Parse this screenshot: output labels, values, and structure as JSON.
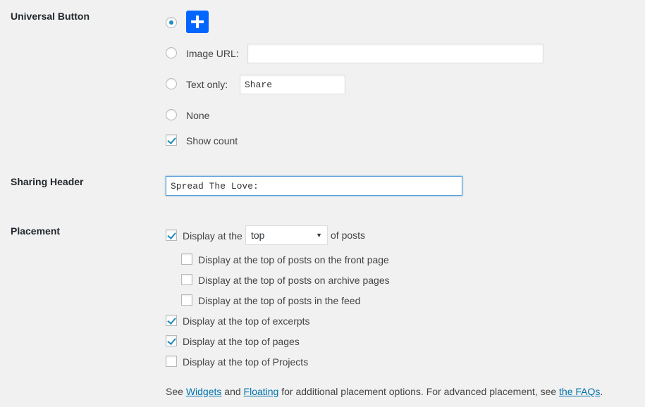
{
  "universal_button": {
    "label": "Universal Button",
    "image_url_label": "Image URL:",
    "image_url_value": "",
    "text_only_label": "Text only:",
    "text_only_value": "Share",
    "none_label": "None",
    "show_count_label": "Show count",
    "selected": "plus-icon",
    "show_count": true,
    "icon_color": "#0166ff"
  },
  "sharing_header": {
    "label": "Sharing Header",
    "value": "Spread The Love:"
  },
  "placement": {
    "label": "Placement",
    "display_prefix": "Display at the",
    "position_value": "top",
    "display_suffix": "of posts",
    "options": [
      {
        "label": "Display at the top of posts on the front page",
        "checked": false
      },
      {
        "label": "Display at the top of posts on archive pages",
        "checked": false
      },
      {
        "label": "Display at the top of posts in the feed",
        "checked": false
      },
      {
        "label": "Display at the top of excerpts",
        "checked": true
      },
      {
        "label": "Display at the top of pages",
        "checked": true
      },
      {
        "label": "Display at the top of Projects",
        "checked": false
      }
    ],
    "footer": {
      "see": "See",
      "widgets": "Widgets",
      "and": "and",
      "floating": "Floating",
      "middle": "for additional placement options. For advanced placement, see",
      "faqs": "the FAQs",
      "end": "."
    }
  }
}
